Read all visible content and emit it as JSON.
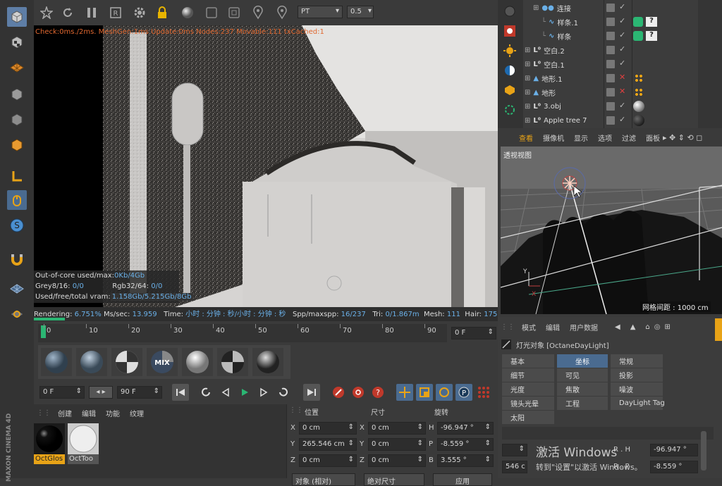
{
  "toolbar": {
    "render_mode": "PT",
    "render_value": "0.5"
  },
  "viewport": {
    "stats_top": "Check:0ms./2ms. MeshGen:1ms Update:0ms Nodes:237 Movable:111 txCached:1",
    "overlay": [
      {
        "label": "Out-of-core used/max:",
        "value": "0Kb/4Gb"
      },
      {
        "label": "Grey8/16:",
        "value": "0/0",
        "label2": "Rgb32/64:",
        "value2": "0/0"
      },
      {
        "label": "Used/free/total vram:",
        "value": "1.158Gb/5.215Gb/8Gb"
      }
    ],
    "status": {
      "rendering_label": "Rendering:",
      "rendering_value": "6.751%",
      "ms_label": "Ms/sec:",
      "ms_value": "13.959",
      "time_label": "Time:",
      "time_value": "小时 : 分钟 : 秒/小时 : 分钟 : 秒",
      "spp_label": "Spp/maxspp:",
      "spp_value": "16/237",
      "tri_label": "Tri:",
      "tri_value": "0/1.867m",
      "mesh_label": "Mesh:",
      "mesh_value": "111",
      "hair_label": "Hair:",
      "hair_value": "175"
    },
    "progress_fraction": 0.0675
  },
  "timeline": {
    "ticks": [
      "0",
      "10",
      "20",
      "30",
      "40",
      "50",
      "60",
      "70",
      "80",
      "90"
    ],
    "current_frame": "0 F",
    "start_frame": "0 F",
    "end_frame": "90 F"
  },
  "materials": {
    "tabs": [
      "创建",
      "编辑",
      "功能",
      "纹理"
    ],
    "items": [
      {
        "name": "OctGlos"
      },
      {
        "name": "OctToo"
      }
    ]
  },
  "coords": {
    "headers": {
      "position": "位置",
      "size": "尺寸",
      "rotation": "旋转"
    },
    "rows": [
      {
        "axis": "X",
        "pos": "0 cm",
        "size_axis": "X",
        "size": "0 cm",
        "rot_axis": "H",
        "rot": "-96.947 °"
      },
      {
        "axis": "Y",
        "pos": "265.546 cm",
        "size_axis": "Y",
        "size": "0 cm",
        "rot_axis": "P",
        "rot": "-8.559 °"
      },
      {
        "axis": "Z",
        "pos": "0 cm",
        "size_axis": "Z",
        "size": "0 cm",
        "rot_axis": "B",
        "rot": "3.555 °"
      }
    ],
    "btn1": "对象 (相对)",
    "btn2": "绝对尺寸",
    "apply": "应用"
  },
  "objects": [
    {
      "name": "连接",
      "depth": 2,
      "type": "connect"
    },
    {
      "name": "样条.1",
      "depth": 3,
      "type": "spline"
    },
    {
      "name": "样条",
      "depth": 3,
      "type": "spline"
    },
    {
      "name": "空白.2",
      "depth": 1,
      "type": "null"
    },
    {
      "name": "空白.1",
      "depth": 1,
      "type": "null"
    },
    {
      "name": "地形.1",
      "depth": 1,
      "type": "terrain"
    },
    {
      "name": "地形",
      "depth": 1,
      "type": "terrain"
    },
    {
      "name": "3.obj",
      "depth": 1,
      "type": "null"
    },
    {
      "name": "Apple tree 7",
      "depth": 1,
      "type": "null"
    }
  ],
  "view_menu": [
    "查看",
    "摄像机",
    "显示",
    "选项",
    "过滤",
    "面板"
  ],
  "view_label": "透视视图",
  "grid_label": "网格间距 : 1000 cm",
  "attr": {
    "menu": [
      "模式",
      "编辑",
      "用户数据"
    ],
    "title": "灯光对象 [OctaneDayLight]",
    "tabs": [
      [
        "基本",
        "坐标",
        "常规"
      ],
      [
        "细节",
        "可见",
        "投影"
      ],
      [
        "光度",
        "焦散",
        "噪波"
      ],
      [
        "镜头光晕",
        "工程",
        "DayLight Tag"
      ],
      [
        "太阳"
      ]
    ],
    "selected_tab": "坐标",
    "r_label": "R . H",
    "r_value": "-96.947 °",
    "p_row_left": "546 c",
    "p_label": "R . P",
    "p_value": "-8.559 °"
  },
  "watermark": {
    "line1": "激活 Windows",
    "line2": "转到\"设置\"以激活 Windows。"
  },
  "brand": "MAXON CINEMA 4D",
  "colors": {
    "accent": "#4a6b90",
    "orange": "#e8a317",
    "green": "#2bb673"
  }
}
